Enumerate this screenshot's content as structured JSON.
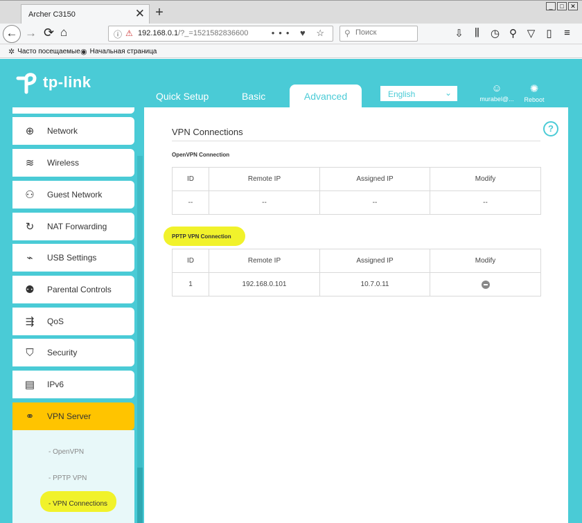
{
  "browser": {
    "tab_title": "Archer C3150",
    "tab_close": "✕",
    "new_tab": "+",
    "window_controls": [
      "_",
      "□",
      "✕"
    ],
    "url_host": "192.168.0.1",
    "url_path": "/?_=1521582836600",
    "url_actions": "••• ♥ ☆",
    "search_placeholder": "Поиск",
    "bookmarks": [
      "Часто посещаемые",
      "Начальная страница"
    ],
    "icons": {
      "back": "←",
      "forward": "→",
      "reload": "⟳",
      "home": "⌂",
      "info": "ⓘ",
      "insecure": "⚠",
      "search": "⚲",
      "bookmark1": "✲",
      "bookmark2": "◉",
      "toolbar": [
        "⇩",
        "⫼",
        "◷",
        "⚲",
        "▽",
        "▯",
        "≡"
      ]
    }
  },
  "router": {
    "brand": "tp-link",
    "nav_tabs": [
      "Quick Setup",
      "Basic",
      "Advanced"
    ],
    "active_tab": "Advanced",
    "language": "English",
    "user_label": "murabel@...",
    "reboot_label": "Reboot",
    "colors": {
      "accent": "#4acbd6",
      "active_item": "#ffc400",
      "highlight": "#f1f22b"
    }
  },
  "sidebar": {
    "items": [
      {
        "label": "Network",
        "icon": "globe-icon",
        "glyph": "⊕"
      },
      {
        "label": "Wireless",
        "icon": "wifi-icon",
        "glyph": "≋"
      },
      {
        "label": "Guest Network",
        "icon": "users-icon",
        "glyph": "⚇"
      },
      {
        "label": "NAT Forwarding",
        "icon": "nat-icon",
        "glyph": "↻"
      },
      {
        "label": "USB Settings",
        "icon": "usb-icon",
        "glyph": "⌁"
      },
      {
        "label": "Parental Controls",
        "icon": "parental-icon",
        "glyph": "⚉"
      },
      {
        "label": "QoS",
        "icon": "qos-icon",
        "glyph": "⇶"
      },
      {
        "label": "Security",
        "icon": "shield-icon",
        "glyph": "⛉"
      },
      {
        "label": "IPv6",
        "icon": "ipv6-icon",
        "glyph": "▤"
      },
      {
        "label": "VPN Server",
        "icon": "vpn-link-icon",
        "glyph": "⚭"
      }
    ],
    "sub_items": [
      "- OpenVPN",
      "- PPTP VPN",
      "- VPN Connections"
    ]
  },
  "main": {
    "title": "VPN Connections",
    "help": "?",
    "openvpn": {
      "title": "OpenVPN Connection",
      "columns": [
        "ID",
        "Remote IP",
        "Assigned IP",
        "Modify"
      ],
      "rows": [
        [
          "--",
          "--",
          "--",
          "--"
        ]
      ]
    },
    "pptp": {
      "title": "PPTP VPN Connection",
      "columns": [
        "ID",
        "Remote IP",
        "Assigned IP",
        "Modify"
      ],
      "rows": [
        [
          "1",
          "192.168.0.101",
          "10.7.0.11"
        ]
      ]
    }
  }
}
